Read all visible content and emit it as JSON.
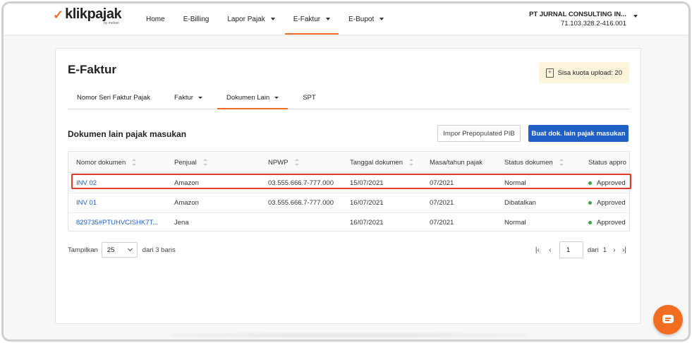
{
  "app": {
    "logo_mark": "✓",
    "logo_text": "klikpajak",
    "logo_sub": "by mekari"
  },
  "nav": {
    "items": [
      {
        "label": "Home",
        "dropdown": false
      },
      {
        "label": "E-Billing",
        "dropdown": false
      },
      {
        "label": "Lapor Pajak",
        "dropdown": true
      },
      {
        "label": "E-Faktur",
        "dropdown": true,
        "active": true
      },
      {
        "label": "E-Bupot",
        "dropdown": true
      }
    ],
    "company_name": "PT JURNAL CONSULTING IN...",
    "company_npwp": "71.103.328.2-416.001"
  },
  "page": {
    "title": "E-Faktur",
    "quota_label": "Sisa kuota upload: 20",
    "quota_icon": "file-upload-icon",
    "tabs": [
      {
        "label": "Nomor Seri Faktur Pajak",
        "dropdown": false
      },
      {
        "label": "Faktur",
        "dropdown": true
      },
      {
        "label": "Dokumen Lain",
        "dropdown": true,
        "active": true
      },
      {
        "label": "SPT",
        "dropdown": false
      }
    ],
    "section_title": "Dokumen lain pajak masukan",
    "import_button": "Impor Prepopulated PIB",
    "create_button": "Buat dok. lain pajak masukan"
  },
  "table": {
    "columns": [
      "Nomor dokumen",
      "Penjual",
      "NPWP",
      "Tanggal dokumen",
      "Masa/tahun pajak",
      "Status dokumen",
      "Status appro"
    ],
    "rows": [
      {
        "nomor": "INV 02",
        "penjual": "Amazon",
        "npwp": "03.555.666.7-777.000",
        "tanggal": "15/07/2021",
        "masa": "07/2021",
        "status": "Normal",
        "approval": "Approved",
        "highlighted": true
      },
      {
        "nomor": "INV 01",
        "penjual": "Amazon",
        "npwp": "03.555.666.7-777.000",
        "tanggal": "16/07/2021",
        "masa": "07/2021",
        "status": "Dibatalkan",
        "approval": "Approved"
      },
      {
        "nomor": "829735#PTUHVCISHK7T...",
        "penjual": "Jena",
        "npwp": "",
        "tanggal": "16/07/2021",
        "masa": "07/2021",
        "status": "Normal",
        "approval": "Approved"
      }
    ]
  },
  "pagination": {
    "show_label": "Tampilkan",
    "page_size": "25",
    "total_label": "dari 3 baris",
    "current_page": "1",
    "of_label": "dari",
    "total_pages": "1"
  },
  "colors": {
    "brand": "#f36d21",
    "primary": "#1f5fc6",
    "approved": "#43a047",
    "highlight": "#e0392b"
  }
}
